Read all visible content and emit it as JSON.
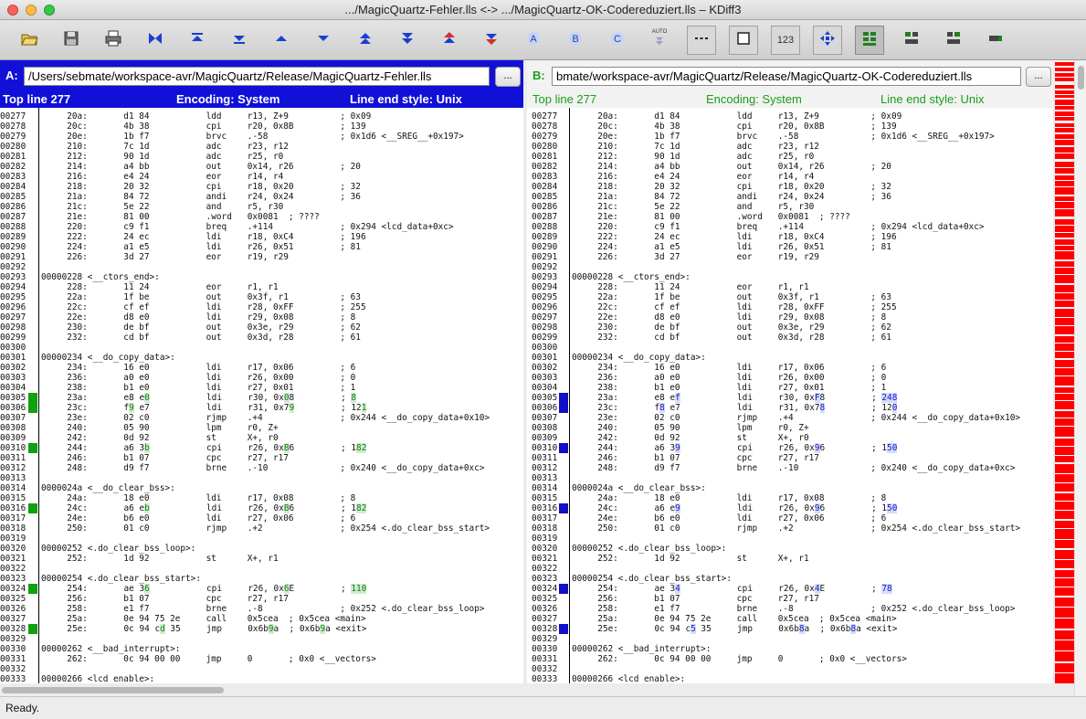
{
  "window": {
    "title": ".../MagicQuartz-Fehler.lls <-> .../MagicQuartz-OK-Codereduziert.lls – KDiff3"
  },
  "toolbar": {
    "buttons": [
      {
        "name": "open-icon"
      },
      {
        "name": "save-icon"
      },
      {
        "name": "print-icon"
      },
      {
        "name": "merge-icon"
      },
      {
        "name": "go-top-icon"
      },
      {
        "name": "go-bottom-icon"
      },
      {
        "name": "prev-delta-icon"
      },
      {
        "name": "next-delta-icon"
      },
      {
        "name": "prev-conflict-icon"
      },
      {
        "name": "next-conflict-icon"
      },
      {
        "name": "prev-unsolved-icon"
      },
      {
        "name": "next-unsolved-icon"
      },
      {
        "name": "choose-a-icon"
      },
      {
        "name": "choose-b-icon"
      },
      {
        "name": "choose-c-icon"
      },
      {
        "name": "auto-solve-icon"
      },
      {
        "name": "show-whitespace-icon"
      },
      {
        "name": "show-whitespace-chars-icon"
      },
      {
        "name": "line-numbers-icon"
      },
      {
        "name": "overview-icon"
      },
      {
        "name": "split-horizontal-icon"
      },
      {
        "name": "window-a-icon"
      },
      {
        "name": "window-b-icon"
      },
      {
        "name": "window-c-icon"
      }
    ],
    "auto_label": "AUTO",
    "numbers_label": "123"
  },
  "panelA": {
    "label": "A:",
    "path": "/Users/sebmate/workspace-avr/MagicQuartz/Release/MagicQuartz-Fehler.lls",
    "browse_label": "...",
    "top_line": "Top line 277",
    "encoding": "Encoding: System",
    "line_end": "Line end style: Unix",
    "lines": [
      [
        "00277",
        "     20a:       d1 84           ldd     r13, Z+9          ; 0x09"
      ],
      [
        "00278",
        "     20c:       4b 38           cpi     r20, 0x8B         ; 139"
      ],
      [
        "00279",
        "     20e:       1b f7           brvc    .-58              ; 0x1d6 <__SREG__+0x197>"
      ],
      [
        "00280",
        "     210:       7c 1d           adc     r23, r12"
      ],
      [
        "00281",
        "     212:       90 1d           adc     r25, r0"
      ],
      [
        "00282",
        "     214:       a4 bb           out     0x14, r26         ; 20"
      ],
      [
        "00283",
        "     216:       e4 24           eor     r14, r4"
      ],
      [
        "00284",
        "     218:       20 32           cpi     r18, 0x20         ; 32"
      ],
      [
        "00285",
        "     21a:       84 72           andi    r24, 0x24         ; 36"
      ],
      [
        "00286",
        "     21c:       5e 22           and     r5, r30"
      ],
      [
        "00287",
        "     21e:       81 00           .word   0x0081  ; ????"
      ],
      [
        "00288",
        "     220:       c9 f1           breq    .+114             ; 0x294 <lcd_data+0xc>"
      ],
      [
        "00289",
        "     222:       24 ec           ldi     r18, 0xC4         ; 196"
      ],
      [
        "00290",
        "     224:       a1 e5           ldi     r26, 0x51         ; 81"
      ],
      [
        "00291",
        "     226:       3d 27           eor     r19, r29"
      ],
      [
        "00292",
        ""
      ],
      [
        "00293",
        "00000228 <__ctors_end>:"
      ],
      [
        "00294",
        "     228:       11 24           eor     r1, r1"
      ],
      [
        "00295",
        "     22a:       1f be           out     0x3f, r1          ; 63"
      ],
      [
        "00296",
        "     22c:       cf ef           ldi     r28, 0xFF         ; 255"
      ],
      [
        "00297",
        "     22e:       d8 e0           ldi     r29, 0x08         ; 8"
      ],
      [
        "00298",
        "     230:       de bf           out     0x3e, r29         ; 62"
      ],
      [
        "00299",
        "     232:       cd bf           out     0x3d, r28         ; 61"
      ],
      [
        "00300",
        ""
      ],
      [
        "00301",
        "00000234 <__do_copy_data>:"
      ],
      [
        "00302",
        "     234:       16 e0           ldi     r17, 0x06         ; 6"
      ],
      [
        "00303",
        "     236:       a0 e0           ldi     r26, 0x00         ; 0"
      ],
      [
        "00304",
        "     238:       b1 e0           ldi     r27, 0x01         ; 1"
      ],
      [
        "00305",
        "     23a:       e8 e0           ldi     r30, 0x08         ; 8"
      ],
      [
        "00306",
        "     23c:       f9 e7           ldi     r31, 0x79         ; 121"
      ],
      [
        "00307",
        "     23e:       02 c0           rjmp    .+4               ; 0x244 <__do_copy_data+0x10>"
      ],
      [
        "00308",
        "     240:       05 90           lpm     r0, Z+"
      ],
      [
        "00309",
        "     242:       0d 92           st      X+, r0"
      ],
      [
        "00310",
        "     244:       a6 3b           cpi     r26, 0xB6         ; 182"
      ],
      [
        "00311",
        "     246:       b1 07           cpc     r27, r17"
      ],
      [
        "00312",
        "     248:       d9 f7           brne    .-10              ; 0x240 <__do_copy_data+0xc>"
      ],
      [
        "00313",
        ""
      ],
      [
        "00314",
        "0000024a <__do_clear_bss>:"
      ],
      [
        "00315",
        "     24a:       18 e0           ldi     r17, 0x08         ; 8"
      ],
      [
        "00316",
        "     24c:       a6 eb           ldi     r26, 0xB6         ; 182"
      ],
      [
        "00317",
        "     24e:       b6 e0           ldi     r27, 0x06         ; 6"
      ],
      [
        "00318",
        "     250:       01 c0           rjmp    .+2               ; 0x254 <.do_clear_bss_start>"
      ],
      [
        "00319",
        ""
      ],
      [
        "00320",
        "00000252 <.do_clear_bss_loop>:"
      ],
      [
        "00321",
        "     252:       1d 92           st      X+, r1"
      ],
      [
        "00322",
        ""
      ],
      [
        "00323",
        "00000254 <.do_clear_bss_start>:"
      ],
      [
        "00324",
        "     254:       ae 36           cpi     r26, 0x6E         ; 110"
      ],
      [
        "00325",
        "     256:       b1 07           cpc     r27, r17"
      ],
      [
        "00326",
        "     258:       e1 f7           brne    .-8               ; 0x252 <.do_clear_bss_loop>"
      ],
      [
        "00327",
        "     25a:       0e 94 75 2e     call    0x5cea  ; 0x5cea <main>"
      ],
      [
        "00328",
        "     25e:       0c 94 cd 35     jmp     0x6b9a  ; 0x6b9a <exit>"
      ],
      [
        "00329",
        ""
      ],
      [
        "00330",
        "00000262 <__bad_interrupt>:"
      ],
      [
        "00331",
        "     262:       0c 94 00 00     jmp     0       ; 0x0 <__vectors>"
      ],
      [
        "00332",
        ""
      ],
      [
        "00333",
        "00000266 <lcd_enable>:"
      ]
    ]
  },
  "panelB": {
    "label": "B:",
    "path": "bmate/workspace-avr/MagicQuartz/Release/MagicQuartz-OK-Codereduziert.lls",
    "browse_label": "...",
    "top_line": "Top line 277",
    "encoding": "Encoding: System",
    "line_end": "Line end style: Unix",
    "lines": [
      [
        "00277",
        "     20a:       d1 84           ldd     r13, Z+9          ; 0x09"
      ],
      [
        "00278",
        "     20c:       4b 38           cpi     r20, 0x8B         ; 139"
      ],
      [
        "00279",
        "     20e:       1b f7           brvc    .-58              ; 0x1d6 <__SREG__+0x197>"
      ],
      [
        "00280",
        "     210:       7c 1d           adc     r23, r12"
      ],
      [
        "00281",
        "     212:       90 1d           adc     r25, r0"
      ],
      [
        "00282",
        "     214:       a4 bb           out     0x14, r26         ; 20"
      ],
      [
        "00283",
        "     216:       e4 24           eor     r14, r4"
      ],
      [
        "00284",
        "     218:       20 32           cpi     r18, 0x20         ; 32"
      ],
      [
        "00285",
        "     21a:       84 72           andi    r24, 0x24         ; 36"
      ],
      [
        "00286",
        "     21c:       5e 22           and     r5, r30"
      ],
      [
        "00287",
        "     21e:       81 00           .word   0x0081  ; ????"
      ],
      [
        "00288",
        "     220:       c9 f1           breq    .+114             ; 0x294 <lcd_data+0xc>"
      ],
      [
        "00289",
        "     222:       24 ec           ldi     r18, 0xC4         ; 196"
      ],
      [
        "00290",
        "     224:       a1 e5           ldi     r26, 0x51         ; 81"
      ],
      [
        "00291",
        "     226:       3d 27           eor     r19, r29"
      ],
      [
        "00292",
        ""
      ],
      [
        "00293",
        "00000228 <__ctors_end>:"
      ],
      [
        "00294",
        "     228:       11 24           eor     r1, r1"
      ],
      [
        "00295",
        "     22a:       1f be           out     0x3f, r1          ; 63"
      ],
      [
        "00296",
        "     22c:       cf ef           ldi     r28, 0xFF         ; 255"
      ],
      [
        "00297",
        "     22e:       d8 e0           ldi     r29, 0x08         ; 8"
      ],
      [
        "00298",
        "     230:       de bf           out     0x3e, r29         ; 62"
      ],
      [
        "00299",
        "     232:       cd bf           out     0x3d, r28         ; 61"
      ],
      [
        "00300",
        ""
      ],
      [
        "00301",
        "00000234 <__do_copy_data>:"
      ],
      [
        "00302",
        "     234:       16 e0           ldi     r17, 0x06         ; 6"
      ],
      [
        "00303",
        "     236:       a0 e0           ldi     r26, 0x00         ; 0"
      ],
      [
        "00304",
        "     238:       b1 e0           ldi     r27, 0x01         ; 1"
      ],
      [
        "00305",
        "     23a:       e8 ef           ldi     r30, 0xF8         ; 248"
      ],
      [
        "00306",
        "     23c:       f8 e7           ldi     r31, 0x78         ; 120"
      ],
      [
        "00307",
        "     23e:       02 c0           rjmp    .+4               ; 0x244 <__do_copy_data+0x10>"
      ],
      [
        "00308",
        "     240:       05 90           lpm     r0, Z+"
      ],
      [
        "00309",
        "     242:       0d 92           st      X+, r0"
      ],
      [
        "00310",
        "     244:       a6 39           cpi     r26, 0x96         ; 150"
      ],
      [
        "00311",
        "     246:       b1 07           cpc     r27, r17"
      ],
      [
        "00312",
        "     248:       d9 f7           brne    .-10              ; 0x240 <__do_copy_data+0xc>"
      ],
      [
        "00313",
        ""
      ],
      [
        "00314",
        "0000024a <__do_clear_bss>:"
      ],
      [
        "00315",
        "     24a:       18 e0           ldi     r17, 0x08         ; 8"
      ],
      [
        "00316",
        "     24c:       a6 e9           ldi     r26, 0x96         ; 150"
      ],
      [
        "00317",
        "     24e:       b6 e0           ldi     r27, 0x06         ; 6"
      ],
      [
        "00318",
        "     250:       01 c0           rjmp    .+2               ; 0x254 <.do_clear_bss_start>"
      ],
      [
        "00319",
        ""
      ],
      [
        "00320",
        "00000252 <.do_clear_bss_loop>:"
      ],
      [
        "00321",
        "     252:       1d 92           st      X+, r1"
      ],
      [
        "00322",
        ""
      ],
      [
        "00323",
        "00000254 <.do_clear_bss_start>:"
      ],
      [
        "00324",
        "     254:       ae 34           cpi     r26, 0x4E         ; 78"
      ],
      [
        "00325",
        "     256:       b1 07           cpc     r27, r17"
      ],
      [
        "00326",
        "     258:       e1 f7           brne    .-8               ; 0x252 <.do_clear_bss_loop>"
      ],
      [
        "00327",
        "     25a:       0e 94 75 2e     call    0x5cea  ; 0x5cea <main>"
      ],
      [
        "00328",
        "     25e:       0c 94 c5 35     jmp     0x6b8a  ; 0x6b8a <exit>"
      ],
      [
        "00329",
        ""
      ],
      [
        "00330",
        "00000262 <__bad_interrupt>:"
      ],
      [
        "00331",
        "     262:       0c 94 00 00     jmp     0       ; 0x0 <__vectors>"
      ],
      [
        "00332",
        ""
      ],
      [
        "00333",
        "00000266 <lcd_enable>:"
      ]
    ]
  },
  "diff_lines": [
    "00305",
    "00306",
    "00310",
    "00316",
    "00324",
    "00328"
  ],
  "colors": {
    "panel_a_accent": "#1010d8",
    "panel_b_accent": "#18a018",
    "diff_marker_a": "#10a010",
    "diff_marker_b": "#1010c8",
    "overview_diff": "#ff0000"
  },
  "status": {
    "text": "Ready."
  }
}
